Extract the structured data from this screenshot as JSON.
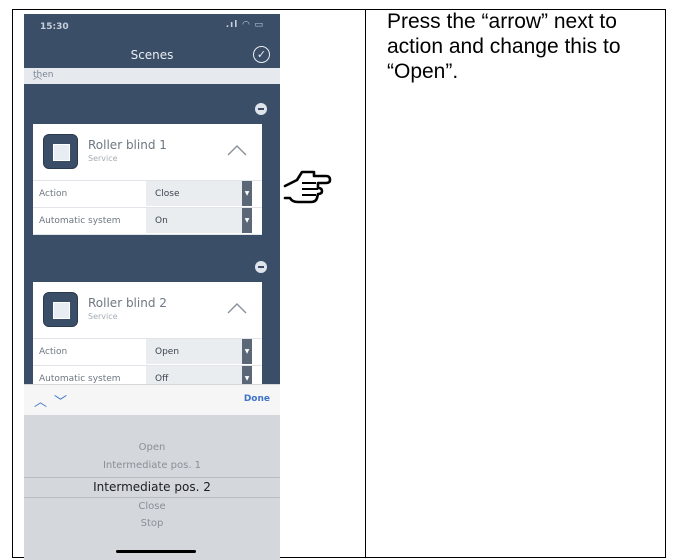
{
  "instruction": "Press the “arrow” next to action and change this to “Open”.",
  "phone": {
    "status_time": "15:30",
    "nav_title": "Scenes",
    "then_label": "then",
    "cards": [
      {
        "name": "Roller blind 1",
        "subtitle": "Service",
        "rows": [
          {
            "label": "Action",
            "value": "Close"
          },
          {
            "label": "Automatic system",
            "value": "On"
          }
        ]
      },
      {
        "name": "Roller blind 2",
        "subtitle": "Service",
        "rows": [
          {
            "label": "Action",
            "value": "Open"
          },
          {
            "label": "Automatic system",
            "value": "Off"
          }
        ]
      }
    ],
    "picker": {
      "done_label": "Done",
      "options": [
        "Open",
        "Intermediate pos. 1",
        "Intermediate pos. 2",
        "Close",
        "Stop"
      ],
      "selected_index": 2
    }
  },
  "icons": {
    "status": "signal-wifi-battery-icons",
    "confirm": "check-circle-icon",
    "collapse": "chevron-up-icon",
    "remove": "minus-circle-icon",
    "blind": "roller-blind-icon",
    "dropdown": "dropdown-arrow-icon",
    "pointer": "pointing-hand-icon"
  },
  "colors": {
    "app_background": "#3b4e67",
    "accent": "#3f73c8"
  }
}
